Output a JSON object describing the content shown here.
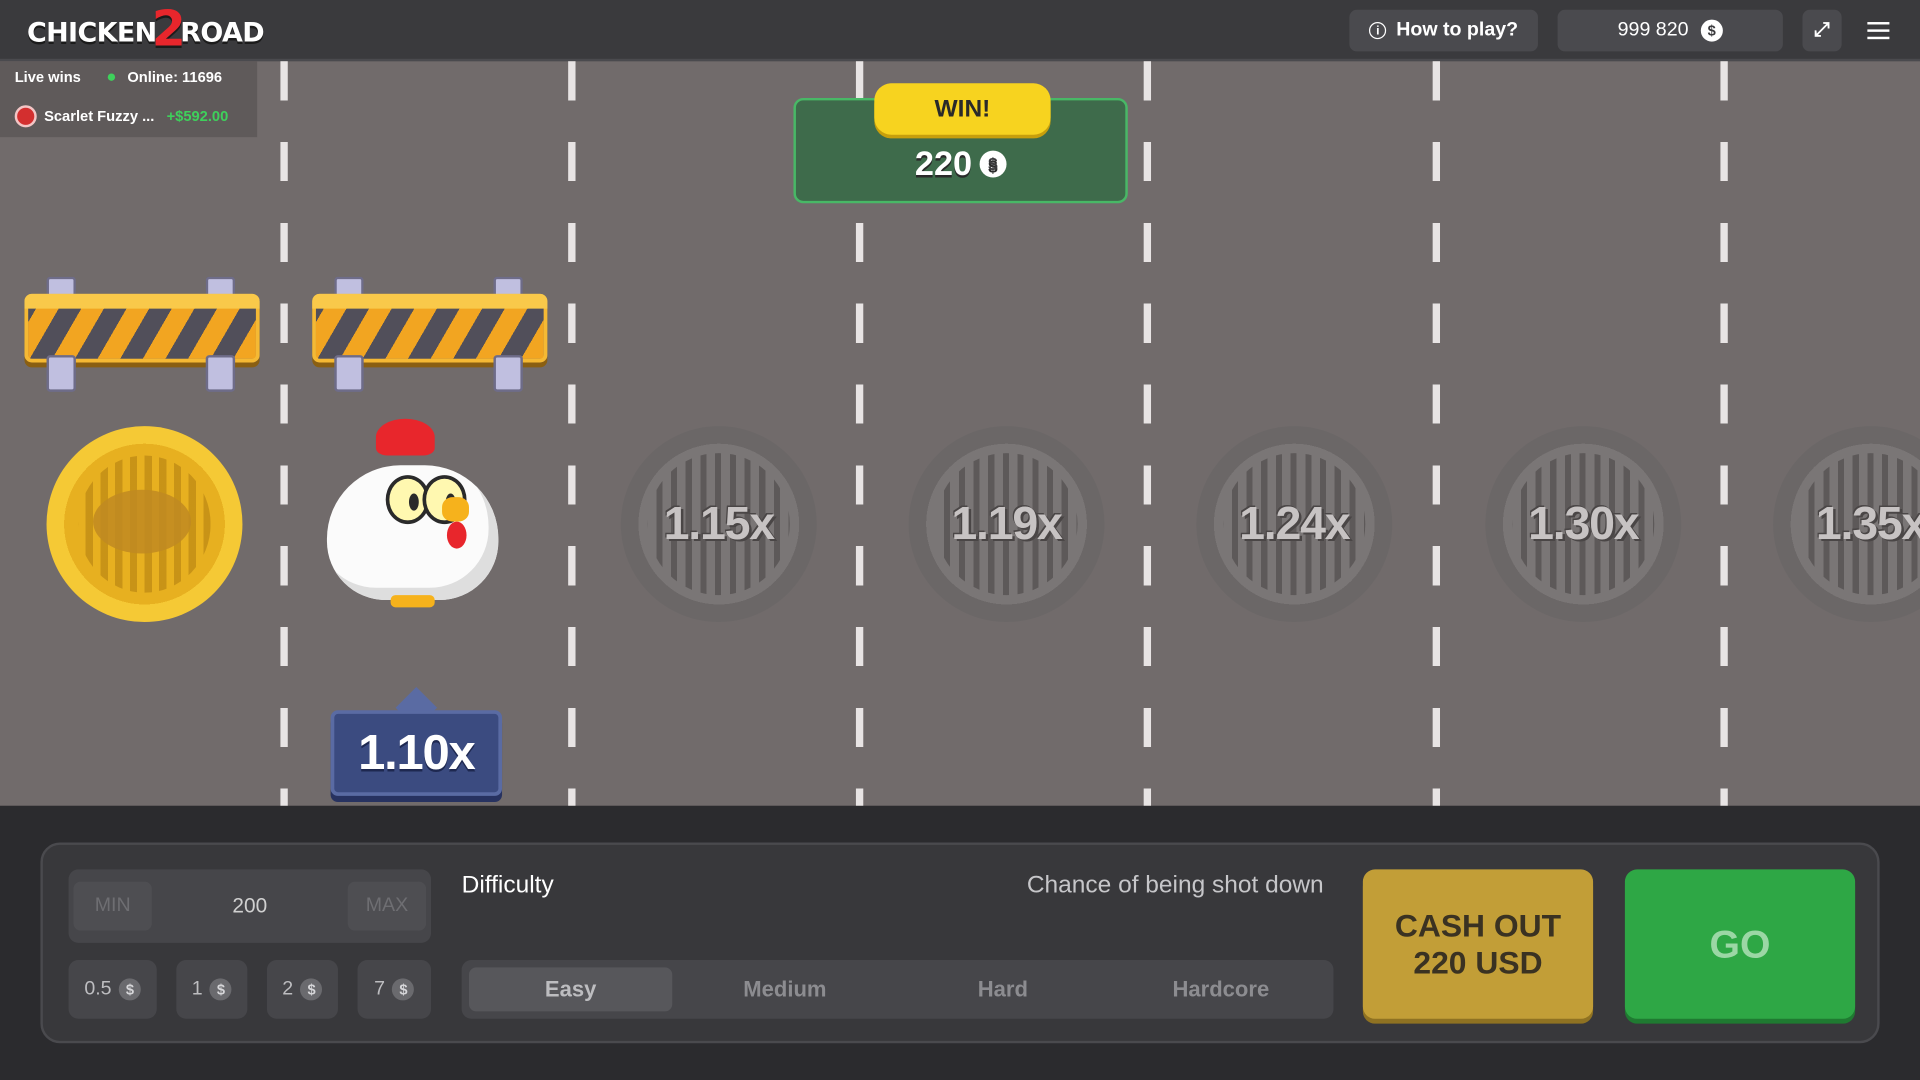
{
  "header": {
    "logo_text_left": "CHICKEN",
    "logo_number": "2",
    "logo_text_right": "ROAD",
    "how_to_play": "How to play?",
    "how_to_play_icon": "info-icon",
    "balance": "999 820",
    "currency_icon": "$",
    "fullscreen_icon": "⤢",
    "menu_icon": "hamburger-menu-icon"
  },
  "live": {
    "label": "Live wins",
    "online": "Online: 11696",
    "recent_winner": {
      "name": "Scarlet Fuzzy ...",
      "amount": "+$592.00"
    }
  },
  "win_popup": {
    "tag": "WIN!",
    "amount": "220",
    "currency": "$"
  },
  "board": {
    "current_multiplier": "1.10x",
    "lanes": [
      {
        "state": "passed",
        "icon": "roast-chicken-gold-coin-icon"
      },
      {
        "state": "current",
        "icon": "chicken-icon",
        "multiplier": "1.10x"
      },
      {
        "state": "ahead",
        "multiplier": "1.15x"
      },
      {
        "state": "ahead",
        "multiplier": "1.19x"
      },
      {
        "state": "ahead",
        "multiplier": "1.24x"
      },
      {
        "state": "ahead",
        "multiplier": "1.30x"
      },
      {
        "state": "ahead",
        "multiplier": "1.35x"
      }
    ]
  },
  "controls": {
    "min_label": "MIN",
    "bet_value": "200",
    "max_label": "MAX",
    "quick_bets": [
      "0.5",
      "1",
      "2",
      "7"
    ],
    "quick_bet_currency": "$",
    "difficulty_label": "Difficulty",
    "chance_label": "Chance of being shot down",
    "difficulties": [
      "Easy",
      "Medium",
      "Hard",
      "Hardcore"
    ],
    "selected_difficulty": "Easy",
    "cashout_line1": "CASH OUT",
    "cashout_line2": "220 USD",
    "go_label": "GO"
  },
  "colors": {
    "road": "#716b6b",
    "win_green": "#3e6b4b",
    "win_yellow": "#f7d31f",
    "cashout_gold": "#c29e37",
    "go_green": "#2ea745",
    "multiplier_blue": "#3b4b80"
  }
}
